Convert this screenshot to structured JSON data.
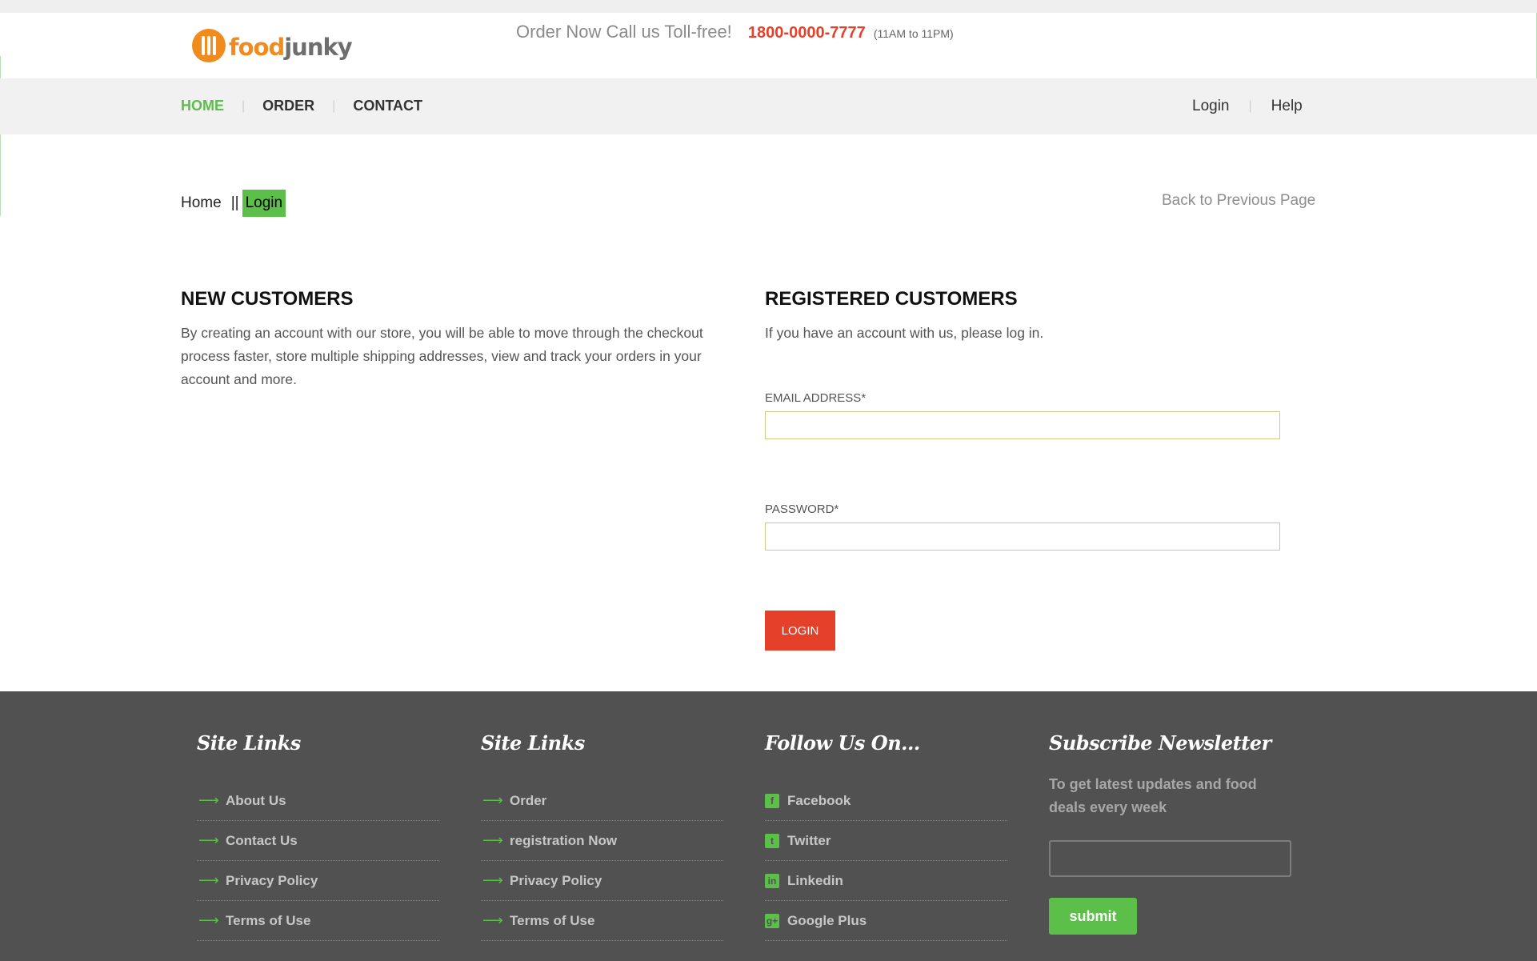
{
  "header": {
    "logo_food": "food",
    "logo_junky": "junky",
    "call_text": "Order Now Call us Toll-free!",
    "phone": "1800-0000-7777",
    "hours": "(11AM to 11PM)"
  },
  "nav": {
    "items": [
      {
        "label": "HOME",
        "active": true
      },
      {
        "label": "ORDER"
      },
      {
        "label": "CONTACT"
      }
    ],
    "right": {
      "login": "Login",
      "help": "Help"
    }
  },
  "breadcrumb": {
    "home": "Home",
    "separator": "||",
    "current": "Login"
  },
  "back_link": "Back to Previous Page",
  "new_customers": {
    "title": "NEW CUSTOMERS",
    "text": "By creating an account with our store, you will be able to move through the checkout process faster, store multiple shipping addresses, view and track your orders in your account and more."
  },
  "registered": {
    "title": "REGISTERED CUSTOMERS",
    "text": "If you have an account with us, please log in.",
    "email_label": "EMAIL ADDRESS*",
    "email_value": "",
    "password_label": "PASSWORD*",
    "password_value": "",
    "login_button": "LOGIN"
  },
  "footer": {
    "col1": {
      "title": "Site Links",
      "links": [
        "About Us",
        "Contact Us",
        "Privacy Policy",
        "Terms of Use"
      ]
    },
    "col2": {
      "title": "Site Links",
      "links": [
        "Order",
        "registration Now",
        "Privacy Policy",
        "Terms of Use"
      ]
    },
    "col3": {
      "title": "Follow Us On...",
      "links": [
        {
          "label": "Facebook",
          "icon": "facebook-icon"
        },
        {
          "label": "Twitter",
          "icon": "twitter-icon"
        },
        {
          "label": "Linkedin",
          "icon": "linkedin-icon"
        },
        {
          "label": "Google Plus",
          "icon": "google-plus-icon"
        }
      ]
    },
    "newsletter": {
      "title": "Subscribe Newsletter",
      "text": "To get latest updates and food deals every week",
      "input_value": "",
      "submit": "submit"
    }
  },
  "colors": {
    "accent_green": "#5cbf4a",
    "accent_red": "#e5412a",
    "logo_orange": "#f08c1e",
    "footer_bg": "#515151"
  }
}
